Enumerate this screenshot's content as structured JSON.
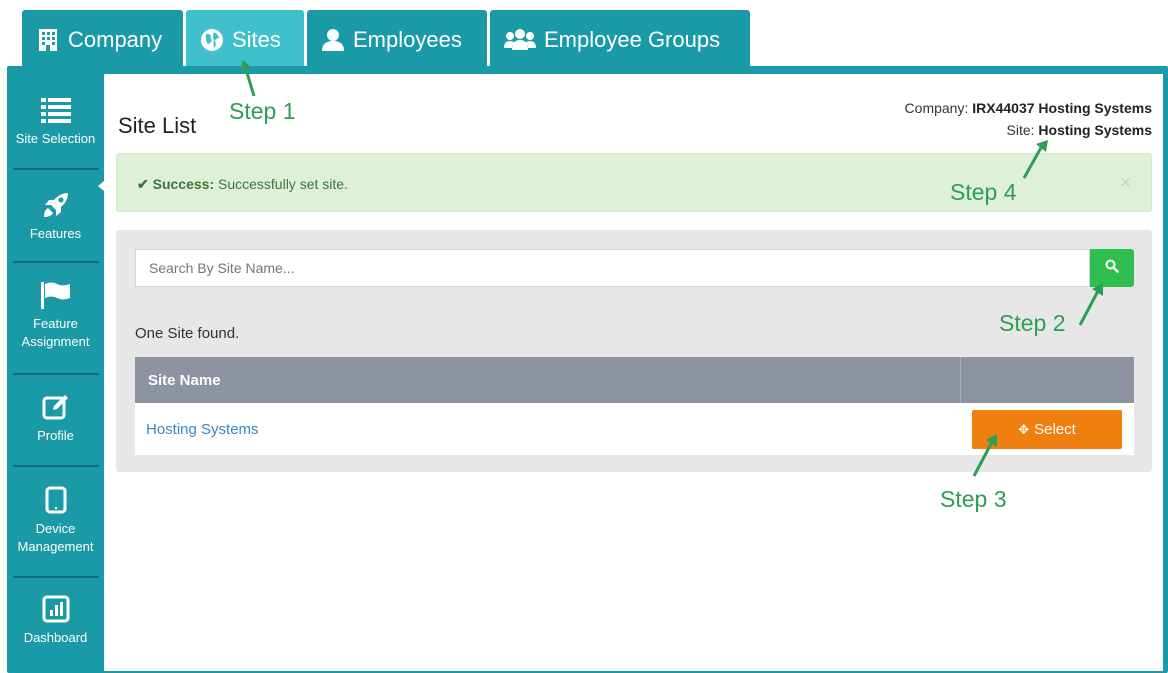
{
  "tabs": [
    {
      "label": "Company",
      "icon": "building-icon"
    },
    {
      "label": "Sites",
      "icon": "globe-icon"
    },
    {
      "label": "Employees",
      "icon": "user-icon"
    },
    {
      "label": "Employee Groups",
      "icon": "users-icon"
    }
  ],
  "active_tab": "Sites",
  "sidebar": {
    "items": [
      {
        "label": "Site Selection",
        "icon": "list-icon"
      },
      {
        "label": "Features",
        "icon": "rocket-icon"
      },
      {
        "label": "Feature Assignment",
        "icon": "flag-icon"
      },
      {
        "label": "Profile",
        "icon": "edit-icon"
      },
      {
        "label": "Device Management",
        "icon": "tablet-icon"
      },
      {
        "label": "Dashboard",
        "icon": "bar-chart-icon"
      }
    ]
  },
  "header": {
    "title": "Site List",
    "company_label": "Company:",
    "company_value": "IRX44037 Hosting Systems",
    "site_label": "Site:",
    "site_value": "Hosting Systems"
  },
  "alert": {
    "strong": "Success:",
    "message": "Successfully set site.",
    "close": "×"
  },
  "search": {
    "placeholder": "Search By Site Name..."
  },
  "results": {
    "count_text": "One Site found.",
    "column_header": "Site Name",
    "rows": [
      {
        "site_name": "Hosting Systems",
        "action": "Select"
      }
    ]
  },
  "annotations": {
    "step1": "Step 1",
    "step2": "Step 2",
    "step3": "Step 3",
    "step4": "Step 4"
  },
  "colors": {
    "teal": "#1a9aa6",
    "teal_active": "#3fc0cc",
    "success_bg": "#dff0d8",
    "search_button": "#2fbf4f",
    "select_button": "#ef7f0f",
    "annotation": "#2e9d56",
    "table_header": "#8d93a0",
    "link": "#3a87c5"
  }
}
